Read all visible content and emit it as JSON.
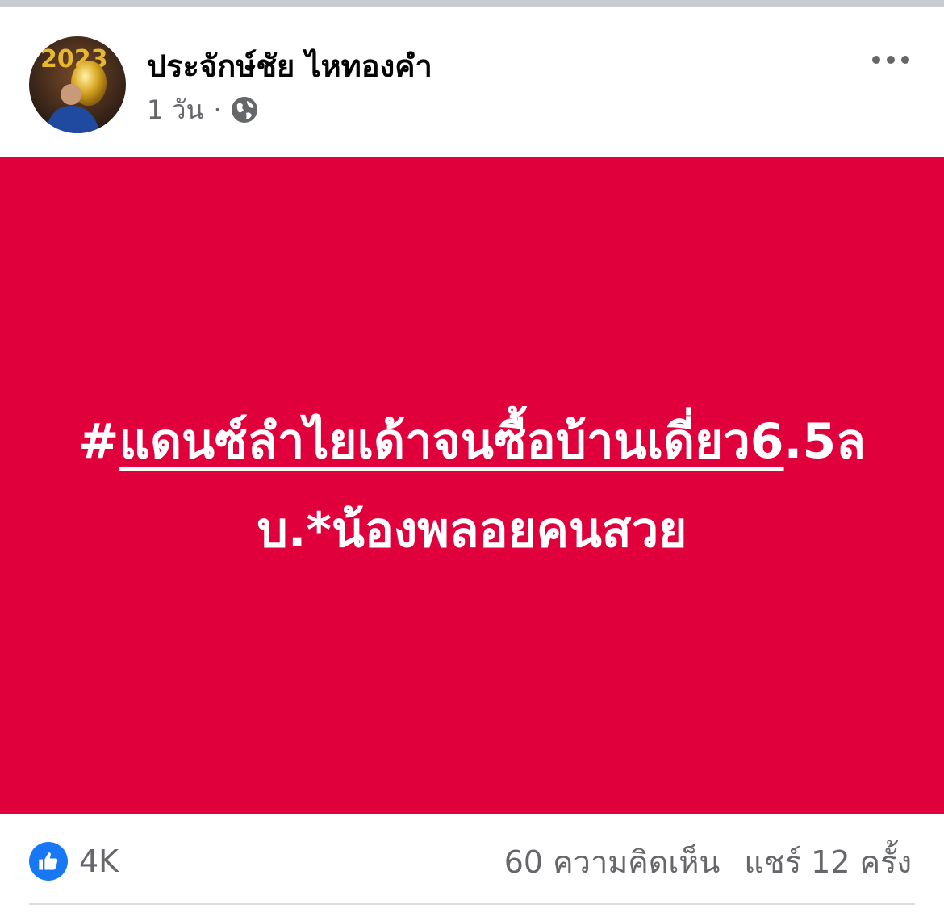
{
  "post": {
    "author": "ประจักษ์ชัย ไหทองคำ",
    "time": "1 วัน",
    "separator": "·",
    "privacy_icon": "globe-icon",
    "menu_icon": "more-horizontal-icon",
    "avatar_badge": "2023",
    "background_color": "#e0003b",
    "hashtag_symbol": "#",
    "hashtag_text": "แดนซ์ลำไยเด้าจนซื้อบ้านเดี่ยว6",
    "body_text": ".5ลบ.*น้องพลอยคนสวย"
  },
  "footer": {
    "reaction_icon": "like-icon",
    "like_count": "4K",
    "comments": "60 ความคิดเห็น",
    "shares": "แชร์ 12 ครั้ง"
  }
}
